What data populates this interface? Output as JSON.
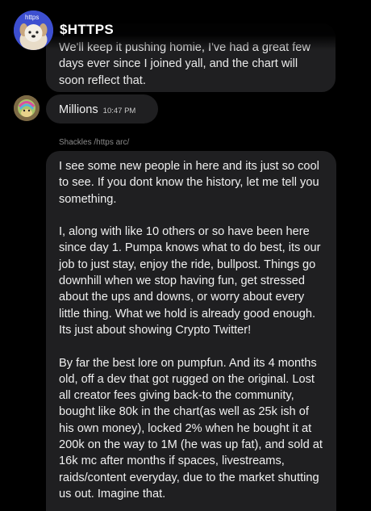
{
  "chat": {
    "title": "$HTTPS",
    "avatar_caption": "https"
  },
  "messages": [
    {
      "text": "We'll keep it pushing homie, I've had a great few days ever since I joined yall, and the chart will soon reflect that."
    },
    {
      "text": "Millions",
      "time": "10:47 PM"
    },
    {
      "reply_to": "Shackles /https arc/",
      "paragraphs": [
        "I see some new people in here and its just so cool to see. If you dont know the history, let me tell you something.",
        "I, along with like 10 others or so have been here since day 1. Pumpa knows what to do best, its our job to just stay, enjoy the ride, bullpost. Things go downhill when we stop having fun, get stressed about the ups and downs, or worry about every little thing. What we hold is already good enough. Its just about showing Crypto Twitter!",
        "By far the best lore on pumpfun. And its 4 months old, off a dev that got rugged on the original. Lost all creator fees giving back-to the community, bought like 80k in the chart(as well as 25k ish of his own money), locked 2% when he bought it at 200k on the way to 1M (he was up fat), and sold at 16k mc after months if spaces, livestreams, raids/content everyday, due to the market shutting us out. Imagine that."
      ]
    }
  ]
}
